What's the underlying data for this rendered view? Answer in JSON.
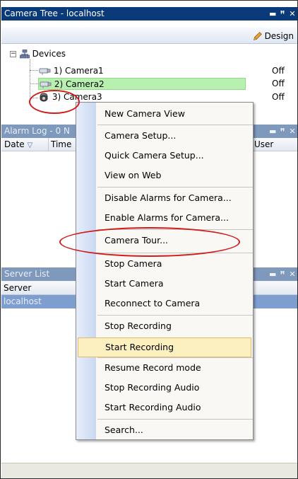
{
  "camera_tree": {
    "title": "Camera Tree - localhost",
    "pin_icon": "pin-icon",
    "close_icon": "close-icon",
    "toolbar": {
      "design_label": "Design"
    },
    "root_label": "Devices",
    "cameras": [
      {
        "label": "1) Camera1",
        "status": "Off"
      },
      {
        "label": "2) Camera2",
        "status": "Off"
      },
      {
        "label": "3) Camera3",
        "status": "Off"
      }
    ]
  },
  "alarm_log": {
    "title": "Alarm Log - 0 N",
    "columns": {
      "date": "Date",
      "time": "Time",
      "user": "User"
    }
  },
  "server_list": {
    "title": "Server List",
    "column": "Server",
    "rows": [
      "localhost"
    ]
  },
  "context_menu": {
    "items": [
      "New Camera View",
      "Camera Setup...",
      "Quick Camera Setup...",
      "View on Web",
      "Disable Alarms for Camera...",
      "Enable Alarms for Camera...",
      "Camera Tour...",
      "Stop Camera",
      "Start Camera",
      "Reconnect to Camera",
      "Stop Recording",
      "Start Recording",
      "Resume Record mode",
      "Stop Recording Audio",
      "Start Recording Audio",
      "Search..."
    ],
    "highlighted": "Start Recording"
  },
  "colors": {
    "active_title": "#0a3a7a",
    "inactive_title": "#7f99bd",
    "selection_green": "#b8f0b0",
    "menu_highlight": "#fcf0c1",
    "annotation_red": "#d21b1b"
  }
}
